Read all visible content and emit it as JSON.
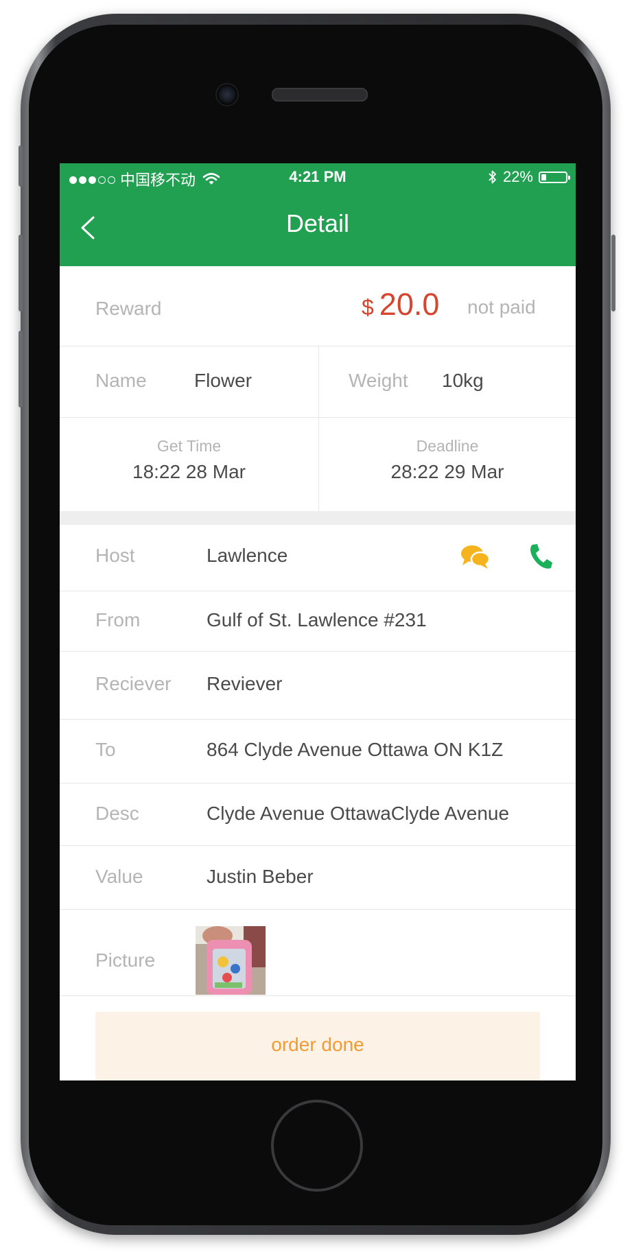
{
  "status_bar": {
    "carrier": "中国移不动",
    "time": "4:21 PM",
    "battery": "22%",
    "battery_level": 0.22
  },
  "nav": {
    "title": "Detail",
    "back_icon": "chevron-left-icon"
  },
  "reward": {
    "label": "Reward",
    "currency": "$",
    "amount": "20.0",
    "status": "not paid"
  },
  "item": {
    "name_label": "Name",
    "name_value": "Flower",
    "weight_label": "Weight",
    "weight_value": "10kg"
  },
  "times": {
    "get_time_label": "Get Time",
    "get_time_value": "18:22 28 Mar",
    "deadline_label": "Deadline",
    "deadline_value": "28:22 29 Mar"
  },
  "details": {
    "host_label": "Host",
    "host_value": "Lawlence",
    "from_label": "From",
    "from_value": "Gulf of St. Lawlence #231",
    "receiver_label": "Reciever",
    "receiver_value": "Reviever",
    "to_label": "To",
    "to_value": "864 Clyde Avenue Ottawa ON K1Z",
    "desc_label": "Desc",
    "desc_value": "Clyde Avenue OttawaClyde Avenue",
    "value_label": "Value",
    "value_value": "Justin Beber",
    "picture_label": "Picture"
  },
  "actions": {
    "order_done": "order done"
  },
  "colors": {
    "brand_green": "#22a052",
    "reward_red": "#d6452e",
    "chat_yellow": "#f5b41e",
    "phone_green": "#1db05a",
    "button_bg": "#fdf2e6",
    "button_text": "#f29b33"
  },
  "icons": {
    "chat": "chat-bubbles-icon",
    "phone": "phone-icon",
    "wifi": "wifi-icon",
    "bluetooth": "bluetooth-icon",
    "battery": "battery-icon"
  }
}
